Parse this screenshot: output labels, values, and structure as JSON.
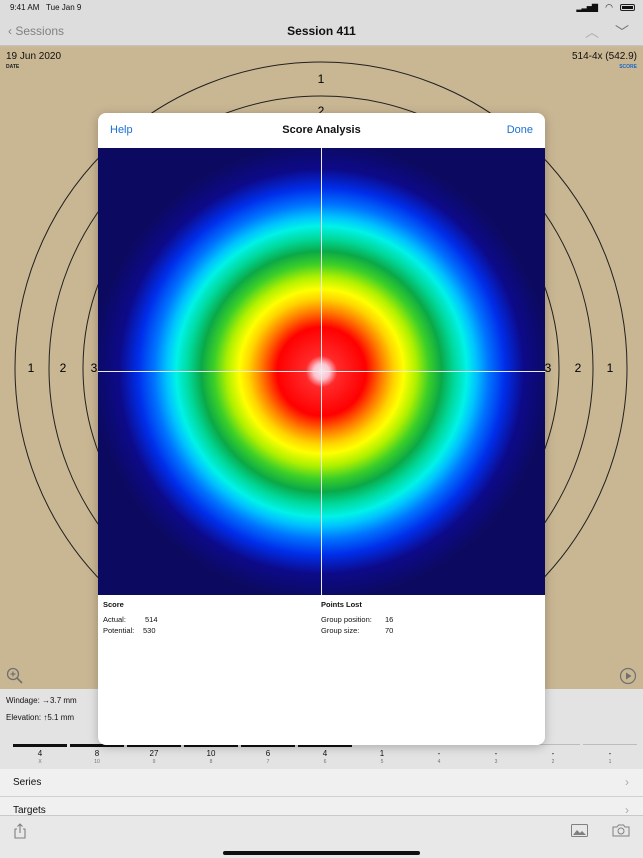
{
  "status_bar": {
    "time": "9:41 AM",
    "date": "Tue Jan 9"
  },
  "nav": {
    "back_label": "Sessions",
    "title": "Session 411"
  },
  "target": {
    "date_value": "19 Jun 2020",
    "date_label": "DATE",
    "score_value": "514-4x (542.9)",
    "score_label": "SCORE",
    "ring_labels": [
      "1",
      "2",
      "3"
    ]
  },
  "info": {
    "windage": "Windage: →3.7 mm",
    "elevation": "Elevation: ↑5.1 mm"
  },
  "distribution": [
    {
      "count": "4",
      "label": "X",
      "level": 1
    },
    {
      "count": "8",
      "label": "10",
      "level": 1
    },
    {
      "count": "27",
      "label": "9",
      "level": 1
    },
    {
      "count": "10",
      "label": "8",
      "level": 1
    },
    {
      "count": "6",
      "label": "7",
      "level": 1
    },
    {
      "count": "4",
      "label": "6",
      "level": 1
    },
    {
      "count": "1",
      "label": "5",
      "level": 0
    },
    {
      "count": "-",
      "label": "4",
      "level": 0
    },
    {
      "count": "-",
      "label": "3",
      "level": 0
    },
    {
      "count": "-",
      "label": "2",
      "level": 0
    },
    {
      "count": "-",
      "label": "1",
      "level": 0
    }
  ],
  "list": {
    "series_label": "Series",
    "targets_label": "Targets"
  },
  "modal": {
    "help_label": "Help",
    "title": "Score Analysis",
    "done_label": "Done",
    "score": {
      "heading": "Score",
      "actual_label": "Actual:",
      "actual_value": "514",
      "potential_label": "Potential:",
      "potential_value": "530"
    },
    "points_lost": {
      "heading": "Points Lost",
      "group_position_label": "Group position:",
      "group_position_value": "16",
      "group_size_label": "Group size:",
      "group_size_value": "70"
    }
  },
  "icons": {
    "back": "chevron-left-icon",
    "up": "chevron-up-icon",
    "down": "chevron-down-icon",
    "zoom": "zoom-in-icon",
    "play": "play-icon",
    "share": "share-icon",
    "photo": "photo-icon",
    "camera": "camera-icon"
  },
  "colors": {
    "accent": "#1a6fd6",
    "target_paper": "#d6c29d"
  }
}
